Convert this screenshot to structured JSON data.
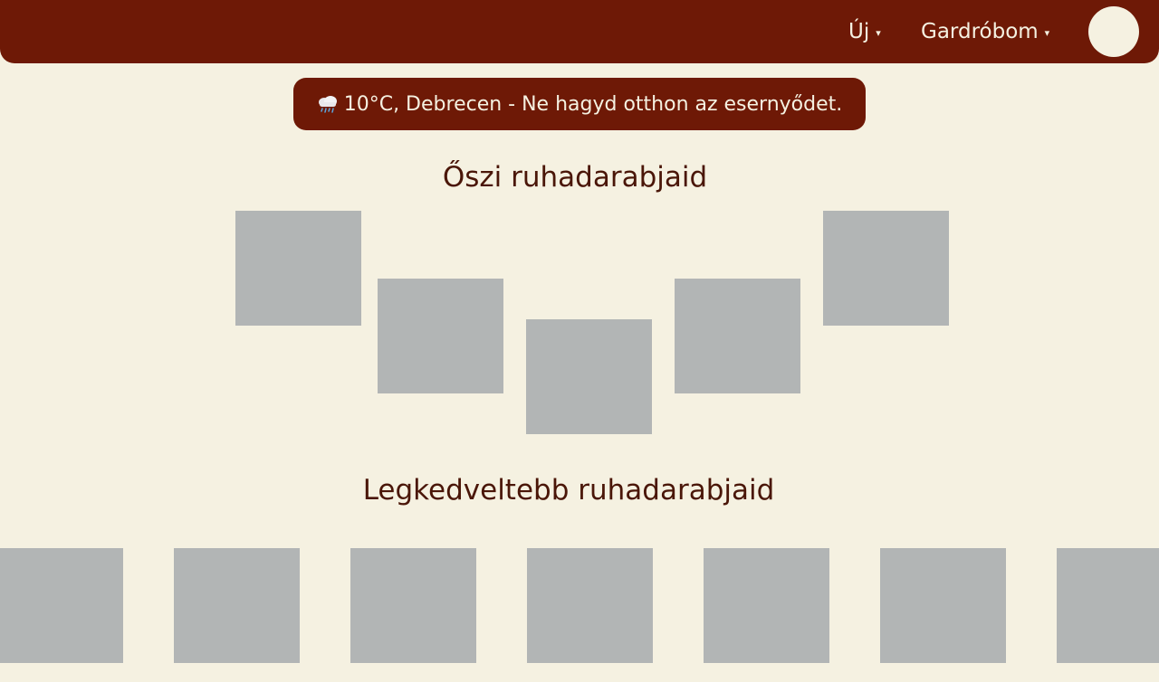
{
  "header": {
    "nav": [
      {
        "label": "Új",
        "caret": "▾"
      },
      {
        "label": "Gardróbom",
        "caret": "▾"
      }
    ],
    "avatar_color": "#f5f1e1",
    "background_color": "#6e1906"
  },
  "weather": {
    "icon": "rain-cloud-icon",
    "text": "10°C, Debrecen - Ne hagyd otthon az esernyődet."
  },
  "sections": {
    "autumn": {
      "title": "Őszi ruhadarabjaid",
      "item_count": 5
    },
    "favorites": {
      "title": "Legkedveltebb ruhadarabjaid",
      "item_count": 7
    }
  },
  "colors": {
    "background": "#f5f1e1",
    "accent": "#6e1906",
    "heading": "#4a1608",
    "placeholder": "#b2b5b5"
  }
}
